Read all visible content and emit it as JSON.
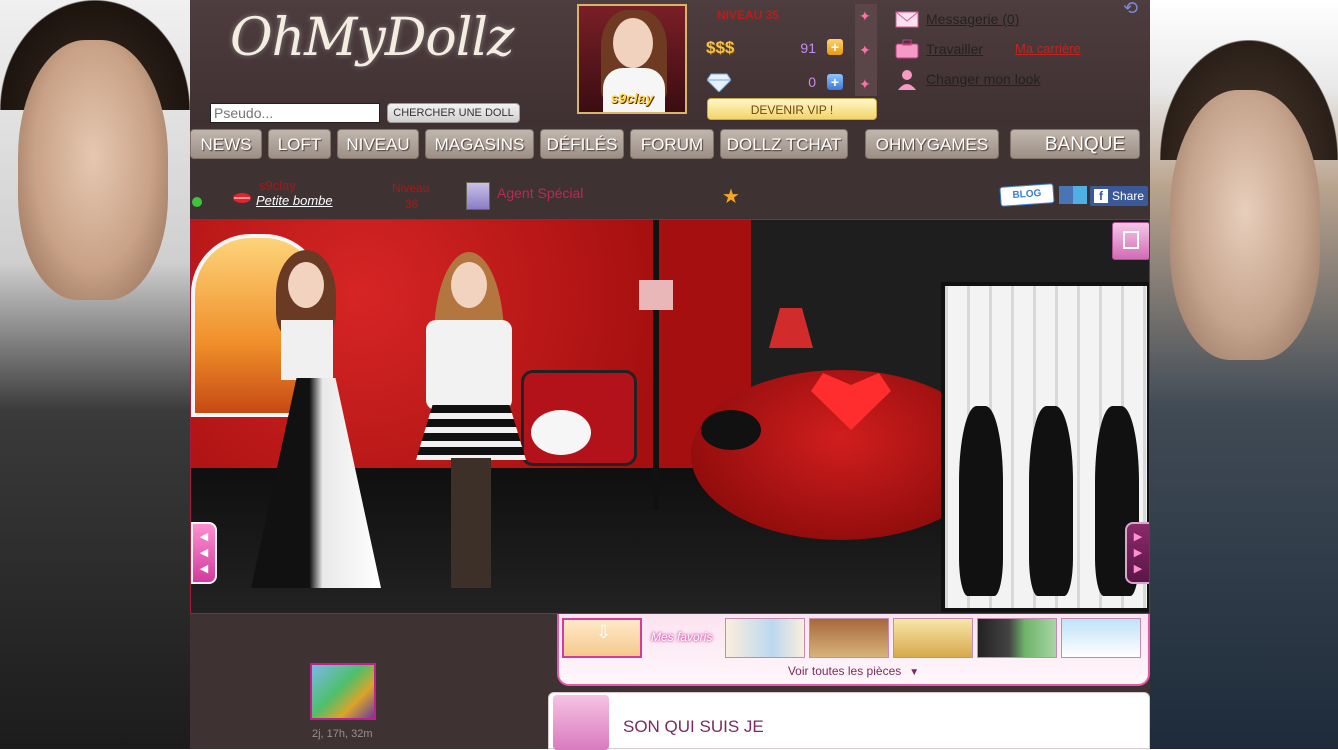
{
  "header": {
    "logo_text": "OhMyDollz",
    "search_placeholder": "Pseudo...",
    "search_button": "CHERCHER UNE DOLL"
  },
  "profile": {
    "avatar_name": "s9clay",
    "niveau_label": "NIVEAU 35",
    "money_label": "$$$",
    "money_value": "91",
    "diamonds_value": "0",
    "vip_button": "DEVENIR VIP !"
  },
  "links": {
    "messages": "Messagerie (0)",
    "travailler": "Travailler",
    "carriere": "Ma carrière",
    "changer_look": "Changer mon look"
  },
  "nav": {
    "items": [
      "NEWS",
      "LOFT",
      "NIVEAU",
      "MAGASINS",
      "DÉFILÉS",
      "FORUM",
      "DOLLZ TCHAT",
      "OHMYGAMES",
      "BANQUE"
    ]
  },
  "status": {
    "username": "s9clay",
    "title": "Petite bombe",
    "niveau_label": "Niveau",
    "niveau_value": "36",
    "agent": "Agent Spécial",
    "blog_label": "BLOG",
    "share_label": "Share"
  },
  "room_strip": {
    "favorites_label": "Mes favoris",
    "voir_all": "Voir toutes les pièces"
  },
  "feed": {
    "time_ago": "2j, 17h, 32m",
    "section_title": "SON QUI SUIS JE"
  },
  "colors": {
    "accent_pink": "#d13c9e",
    "money_gold": "#f4c34a",
    "nav_button": "#a89b92"
  }
}
